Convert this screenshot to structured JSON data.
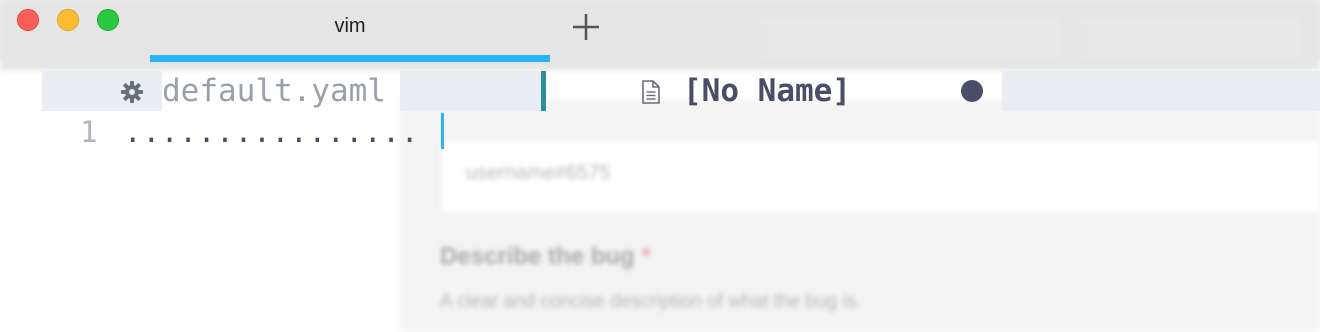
{
  "window": {
    "tab_title": "vim",
    "new_tab_icon": "plus-icon"
  },
  "vim": {
    "tabline": {
      "inactive_icon": "gear-icon",
      "inactive_name": "default.yaml",
      "active_icon": "document-icon",
      "active_name": "[No Name]",
      "modified_indicator": "●"
    },
    "buffer": {
      "line_number": "1",
      "line_content": "................"
    }
  },
  "background_page": {
    "placeholder": "username#6575",
    "heading": "Describe the bug",
    "required_marker": "*",
    "description": "A clear and concise description of what the bug is."
  },
  "colors": {
    "accent": "#29b6f6",
    "separator": "#2a8f99",
    "active_text": "#4a4d68",
    "inactive_text": "#9aa0aa"
  }
}
